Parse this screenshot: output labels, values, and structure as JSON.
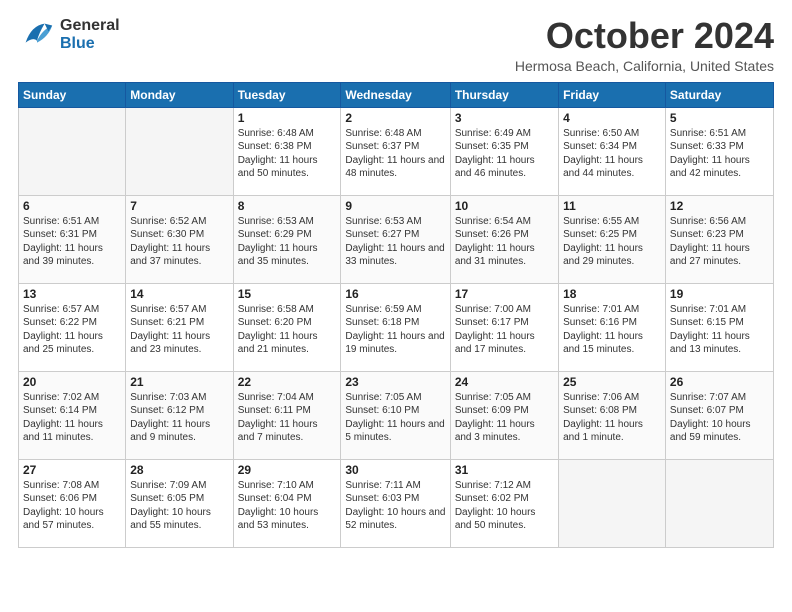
{
  "header": {
    "logo_general": "General",
    "logo_blue": "Blue",
    "month_title": "October 2024",
    "location": "Hermosa Beach, California, United States"
  },
  "calendar": {
    "days_of_week": [
      "Sunday",
      "Monday",
      "Tuesday",
      "Wednesday",
      "Thursday",
      "Friday",
      "Saturday"
    ],
    "weeks": [
      [
        {
          "day": "",
          "info": ""
        },
        {
          "day": "",
          "info": ""
        },
        {
          "day": "1",
          "info": "Sunrise: 6:48 AM\nSunset: 6:38 PM\nDaylight: 11 hours and 50 minutes."
        },
        {
          "day": "2",
          "info": "Sunrise: 6:48 AM\nSunset: 6:37 PM\nDaylight: 11 hours and 48 minutes."
        },
        {
          "day": "3",
          "info": "Sunrise: 6:49 AM\nSunset: 6:35 PM\nDaylight: 11 hours and 46 minutes."
        },
        {
          "day": "4",
          "info": "Sunrise: 6:50 AM\nSunset: 6:34 PM\nDaylight: 11 hours and 44 minutes."
        },
        {
          "day": "5",
          "info": "Sunrise: 6:51 AM\nSunset: 6:33 PM\nDaylight: 11 hours and 42 minutes."
        }
      ],
      [
        {
          "day": "6",
          "info": "Sunrise: 6:51 AM\nSunset: 6:31 PM\nDaylight: 11 hours and 39 minutes."
        },
        {
          "day": "7",
          "info": "Sunrise: 6:52 AM\nSunset: 6:30 PM\nDaylight: 11 hours and 37 minutes."
        },
        {
          "day": "8",
          "info": "Sunrise: 6:53 AM\nSunset: 6:29 PM\nDaylight: 11 hours and 35 minutes."
        },
        {
          "day": "9",
          "info": "Sunrise: 6:53 AM\nSunset: 6:27 PM\nDaylight: 11 hours and 33 minutes."
        },
        {
          "day": "10",
          "info": "Sunrise: 6:54 AM\nSunset: 6:26 PM\nDaylight: 11 hours and 31 minutes."
        },
        {
          "day": "11",
          "info": "Sunrise: 6:55 AM\nSunset: 6:25 PM\nDaylight: 11 hours and 29 minutes."
        },
        {
          "day": "12",
          "info": "Sunrise: 6:56 AM\nSunset: 6:23 PM\nDaylight: 11 hours and 27 minutes."
        }
      ],
      [
        {
          "day": "13",
          "info": "Sunrise: 6:57 AM\nSunset: 6:22 PM\nDaylight: 11 hours and 25 minutes."
        },
        {
          "day": "14",
          "info": "Sunrise: 6:57 AM\nSunset: 6:21 PM\nDaylight: 11 hours and 23 minutes."
        },
        {
          "day": "15",
          "info": "Sunrise: 6:58 AM\nSunset: 6:20 PM\nDaylight: 11 hours and 21 minutes."
        },
        {
          "day": "16",
          "info": "Sunrise: 6:59 AM\nSunset: 6:18 PM\nDaylight: 11 hours and 19 minutes."
        },
        {
          "day": "17",
          "info": "Sunrise: 7:00 AM\nSunset: 6:17 PM\nDaylight: 11 hours and 17 minutes."
        },
        {
          "day": "18",
          "info": "Sunrise: 7:01 AM\nSunset: 6:16 PM\nDaylight: 11 hours and 15 minutes."
        },
        {
          "day": "19",
          "info": "Sunrise: 7:01 AM\nSunset: 6:15 PM\nDaylight: 11 hours and 13 minutes."
        }
      ],
      [
        {
          "day": "20",
          "info": "Sunrise: 7:02 AM\nSunset: 6:14 PM\nDaylight: 11 hours and 11 minutes."
        },
        {
          "day": "21",
          "info": "Sunrise: 7:03 AM\nSunset: 6:12 PM\nDaylight: 11 hours and 9 minutes."
        },
        {
          "day": "22",
          "info": "Sunrise: 7:04 AM\nSunset: 6:11 PM\nDaylight: 11 hours and 7 minutes."
        },
        {
          "day": "23",
          "info": "Sunrise: 7:05 AM\nSunset: 6:10 PM\nDaylight: 11 hours and 5 minutes."
        },
        {
          "day": "24",
          "info": "Sunrise: 7:05 AM\nSunset: 6:09 PM\nDaylight: 11 hours and 3 minutes."
        },
        {
          "day": "25",
          "info": "Sunrise: 7:06 AM\nSunset: 6:08 PM\nDaylight: 11 hours and 1 minute."
        },
        {
          "day": "26",
          "info": "Sunrise: 7:07 AM\nSunset: 6:07 PM\nDaylight: 10 hours and 59 minutes."
        }
      ],
      [
        {
          "day": "27",
          "info": "Sunrise: 7:08 AM\nSunset: 6:06 PM\nDaylight: 10 hours and 57 minutes."
        },
        {
          "day": "28",
          "info": "Sunrise: 7:09 AM\nSunset: 6:05 PM\nDaylight: 10 hours and 55 minutes."
        },
        {
          "day": "29",
          "info": "Sunrise: 7:10 AM\nSunset: 6:04 PM\nDaylight: 10 hours and 53 minutes."
        },
        {
          "day": "30",
          "info": "Sunrise: 7:11 AM\nSunset: 6:03 PM\nDaylight: 10 hours and 52 minutes."
        },
        {
          "day": "31",
          "info": "Sunrise: 7:12 AM\nSunset: 6:02 PM\nDaylight: 10 hours and 50 minutes."
        },
        {
          "day": "",
          "info": ""
        },
        {
          "day": "",
          "info": ""
        }
      ]
    ]
  }
}
